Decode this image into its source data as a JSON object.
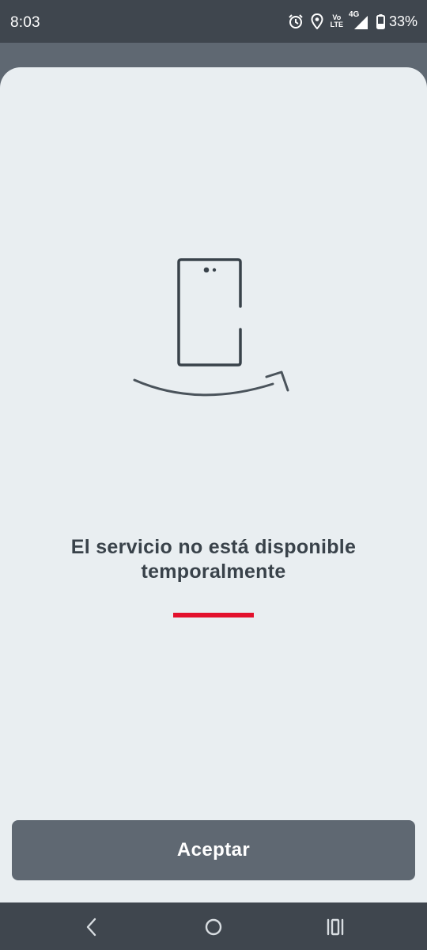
{
  "status_bar": {
    "time": "8:03",
    "network_volte": "Vo",
    "network_lte": "LTE",
    "network_type": "4G",
    "battery_percent": "33%",
    "icons": [
      "alarm-icon",
      "location-icon",
      "volte-icon",
      "signal-icon",
      "battery-icon"
    ]
  },
  "dialog": {
    "message": "El servicio no está disponible temporalmente",
    "illustration": "phone-with-smile-arrow-icon",
    "accent_color": "#e3102c",
    "button_label": "Aceptar"
  },
  "nav_bar": {
    "buttons": [
      "back-icon",
      "home-icon",
      "recents-icon"
    ]
  }
}
